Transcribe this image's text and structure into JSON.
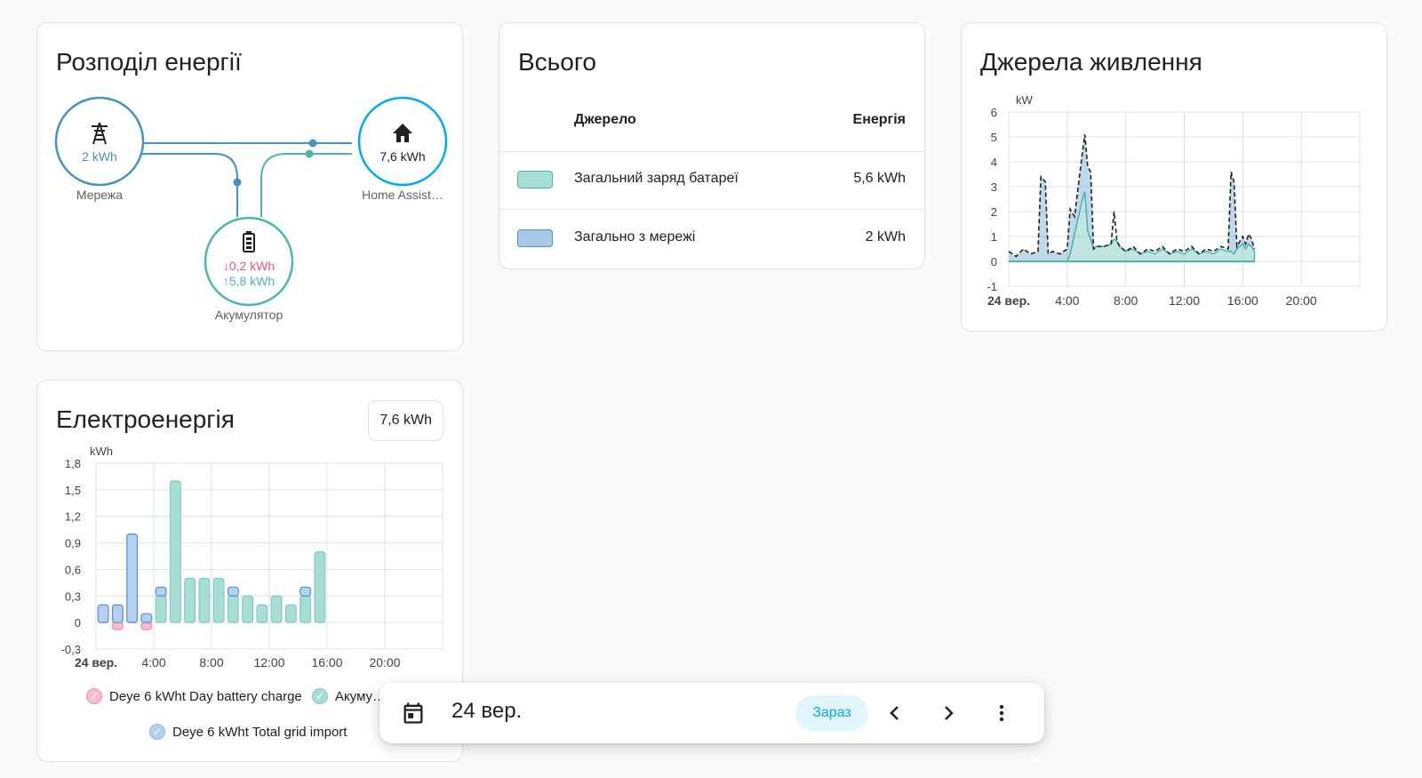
{
  "distribution": {
    "title": "Розподіл енергії",
    "grid": {
      "value": "2 kWh",
      "label": "Мережа",
      "icon": "transmission-tower-icon",
      "color": "#488fc2"
    },
    "home": {
      "value": "7,6 kWh",
      "label": "Home Assist…",
      "icon": "home-icon",
      "color": "#03a9f4"
    },
    "battery": {
      "discharge": "↓0,2 kWh",
      "charge": "↑5,8 kWh",
      "label": "Акумулятор",
      "icon": "battery-icon",
      "color": "#4db6ac"
    }
  },
  "totals": {
    "title": "Всього",
    "header": {
      "source": "Джерело",
      "energy": "Енергія"
    },
    "rows": [
      {
        "label": "Загальний заряд батареї",
        "value": "5,6 kWh",
        "color": "#4db6ac"
      },
      {
        "label": "Загально з мережі",
        "value": "2 kWh",
        "color": "#488fc2"
      }
    ]
  },
  "sources": {
    "title": "Джерела живлення",
    "chart_data": {
      "type": "area",
      "ylabel": "kW",
      "ylim": [
        -1,
        6
      ],
      "yticks": [
        "6",
        "5",
        "4",
        "3",
        "2",
        "1",
        "0",
        "-1"
      ],
      "xticks": [
        "24 вер.",
        "4:00",
        "8:00",
        "12:00",
        "16:00",
        "20:00"
      ],
      "x_hours": [
        0,
        0.5,
        1,
        1.5,
        2,
        2.2,
        2.5,
        2.7,
        3,
        3.5,
        4,
        4.2,
        4.5,
        5,
        5.2,
        5.4,
        5.6,
        5.8,
        6,
        6.5,
        7,
        7.2,
        7.4,
        7.6,
        8,
        8.5,
        9,
        9.5,
        10,
        10.5,
        11,
        11.5,
        12,
        12.5,
        13,
        13.5,
        14,
        14.5,
        15,
        15.2,
        15.4,
        15.6,
        15.8,
        16,
        16.2,
        16.4,
        16.6,
        16.8
      ],
      "series": [
        {
          "name": "",
          "type": "dashed-line",
          "color": "#212121",
          "values": [
            0.4,
            0.2,
            0.5,
            0.3,
            0.4,
            3.4,
            3.2,
            0.3,
            0.4,
            0.3,
            0.5,
            2.1,
            1.8,
            4.2,
            5.1,
            3.8,
            3.6,
            0.5,
            0.6,
            0.6,
            0.7,
            2.0,
            0.8,
            0.6,
            0.4,
            0.6,
            0.3,
            0.5,
            0.4,
            0.6,
            0.3,
            0.5,
            0.4,
            0.6,
            0.3,
            0.5,
            0.4,
            0.6,
            0.5,
            3.6,
            3.2,
            0.6,
            0.8,
            1.0,
            0.7,
            1.1,
            0.9,
            0.5
          ]
        },
        {
          "name": "",
          "type": "area",
          "color": "#4db6ac",
          "values": [
            0,
            0,
            0,
            0,
            0,
            0,
            0,
            0,
            0,
            0,
            0,
            0.3,
            1.1,
            2.4,
            2.8,
            1.2,
            0.9,
            0.5,
            0.6,
            0.6,
            0.7,
            0.9,
            0.8,
            0.6,
            0.4,
            0.5,
            0.3,
            0.4,
            0.3,
            0.5,
            0.3,
            0.4,
            0.3,
            0.5,
            0.3,
            0.4,
            0.3,
            0.5,
            0.4,
            0.4,
            0.3,
            0.5,
            0.6,
            0.7,
            0.5,
            0.7,
            0.6,
            0.4
          ]
        },
        {
          "name": "",
          "type": "area",
          "color": "#488fc2",
          "values": [
            0.4,
            0.2,
            0.5,
            0.3,
            0.4,
            3.4,
            3.2,
            0.3,
            0.4,
            0.3,
            0.5,
            1.8,
            0.7,
            1.8,
            2.3,
            2.6,
            2.7,
            0,
            0,
            0,
            0,
            0,
            0,
            0,
            0,
            0,
            0,
            0,
            0,
            0,
            0,
            0,
            0,
            0,
            0,
            0,
            0,
            0,
            0,
            3.2,
            2.9,
            0.1,
            0.2,
            0.3,
            0.2,
            0.4,
            0.3,
            0.1
          ]
        }
      ]
    }
  },
  "electricity": {
    "title": "Електроенергія",
    "total": "7,6 kWh",
    "chart_data": {
      "type": "bar",
      "ylabel": "kWh",
      "ylim": [
        -0.3,
        1.8
      ],
      "yticks": [
        "1,8",
        "1,5",
        "1,2",
        "0,9",
        "0,6",
        "0,3",
        "0",
        "-0,3"
      ],
      "xticks": [
        "24 вер.",
        "4:00",
        "8:00",
        "12:00",
        "16:00",
        "20:00"
      ],
      "hours": [
        0,
        1,
        2,
        3,
        4,
        5,
        6,
        7,
        8,
        9,
        10,
        11,
        12,
        13,
        14,
        15,
        16
      ],
      "series": [
        {
          "name": "Deye 6 kWht Day battery charge",
          "color": "#f48fb1",
          "values": [
            0,
            -0.05,
            0,
            -0.05,
            0,
            0,
            0,
            0,
            0,
            0,
            0,
            0,
            0,
            0,
            0,
            0,
            0
          ]
        },
        {
          "name": "Акуму…",
          "color": "#80cbc4",
          "values": [
            0,
            0,
            0,
            0,
            0.3,
            1.6,
            0.5,
            0.5,
            0.5,
            0.3,
            0.3,
            0.2,
            0.3,
            0.2,
            0.3,
            0.8,
            0
          ]
        },
        {
          "name": "Deye 6 kWht Total grid import",
          "color": "#90b8e0",
          "values": [
            0.2,
            0.2,
            1.0,
            0.1,
            0.1,
            0,
            0,
            0,
            0,
            0.1,
            0,
            0,
            0,
            0,
            0.1,
            0,
            0
          ]
        }
      ]
    },
    "legend": [
      "Deye 6 kWht Day battery charge",
      "Акуму…",
      "Deye 6 kWht Total grid import"
    ]
  },
  "datebar": {
    "date": "24 вер.",
    "today_label": "Зараз",
    "icons": {
      "calendar": "calendar-icon",
      "prev": "chevron-left-icon",
      "next": "chevron-right-icon",
      "menu": "dots-vertical-icon"
    }
  }
}
